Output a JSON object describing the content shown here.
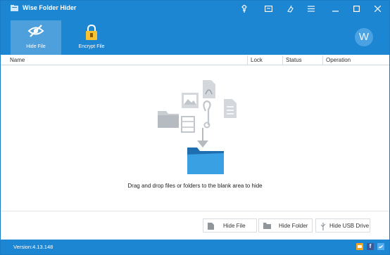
{
  "app": {
    "title": "Wise Folder Hider",
    "version": "Version:4.13.148"
  },
  "titlebar": {
    "buttons": [
      {
        "name": "pin-icon"
      },
      {
        "name": "message-icon"
      },
      {
        "name": "skin-icon"
      },
      {
        "name": "menu-icon"
      },
      {
        "name": "minimize-icon"
      },
      {
        "name": "maximize-icon"
      },
      {
        "name": "close-icon"
      }
    ]
  },
  "toolbar": {
    "hide_file": "Hide File",
    "encrypt_file": "Encrypt File",
    "avatar_initial": "W"
  },
  "columns": {
    "name": "Name",
    "lock": "Lock",
    "status": "Status",
    "operation": "Operation"
  },
  "droparea": {
    "hint": "Drag and drop files or folders to the blank area to hide"
  },
  "actions": {
    "hide_file": "Hide File",
    "hide_folder": "Hide Folder",
    "hide_usb": "Hide USB Drive"
  },
  "statusbar": {
    "feedback_icon": "message-icon",
    "facebook": "f",
    "twitter": "twitter-icon"
  },
  "colors": {
    "accent": "#1d86d2",
    "folder": "#2b8fd6"
  }
}
